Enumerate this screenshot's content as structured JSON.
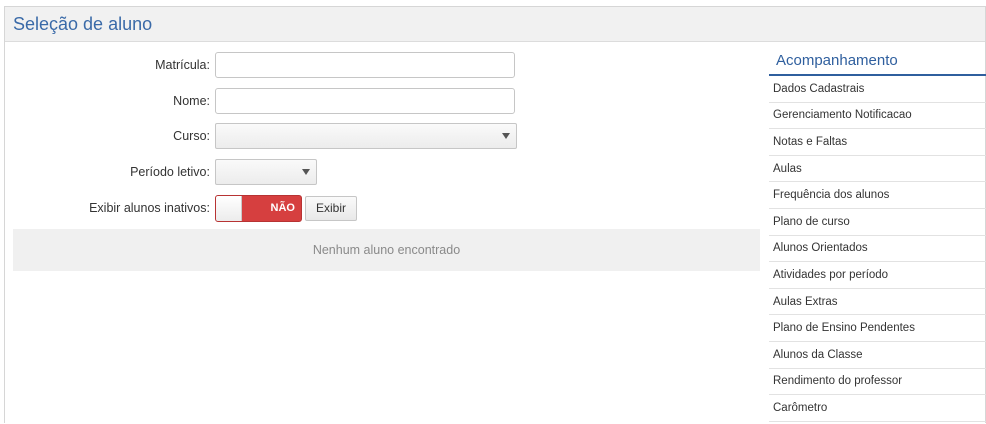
{
  "panel": {
    "title": "Seleção de aluno"
  },
  "form": {
    "matricula": {
      "label": "Matrícula:",
      "value": "",
      "placeholder": ""
    },
    "nome": {
      "label": "Nome:",
      "value": "",
      "placeholder": ""
    },
    "curso": {
      "label": "Curso:",
      "selected": ""
    },
    "periodo": {
      "label": "Período letivo:",
      "selected": ""
    },
    "inativos": {
      "label": "Exibir alunos inativos:",
      "toggle_text": "NÃO"
    },
    "exibir_label": "Exibir",
    "empty_message": "Nenhum aluno encontrado"
  },
  "sidebar": {
    "title": "Acompanhamento",
    "items": [
      {
        "label": "Dados Cadastrais"
      },
      {
        "label": "Gerenciamento Notificacao"
      },
      {
        "label": "Notas e Faltas"
      },
      {
        "label": "Aulas"
      },
      {
        "label": "Frequência dos alunos"
      },
      {
        "label": "Plano de curso"
      },
      {
        "label": "Alunos Orientados"
      },
      {
        "label": "Atividades por período"
      },
      {
        "label": "Aulas Extras"
      },
      {
        "label": "Plano de Ensino Pendentes"
      },
      {
        "label": "Alunos da Classe"
      },
      {
        "label": "Rendimento do professor"
      },
      {
        "label": "Carômetro"
      }
    ]
  },
  "colors": {
    "accent": "#2f5f9e",
    "toggle_off": "#d63f3f"
  }
}
